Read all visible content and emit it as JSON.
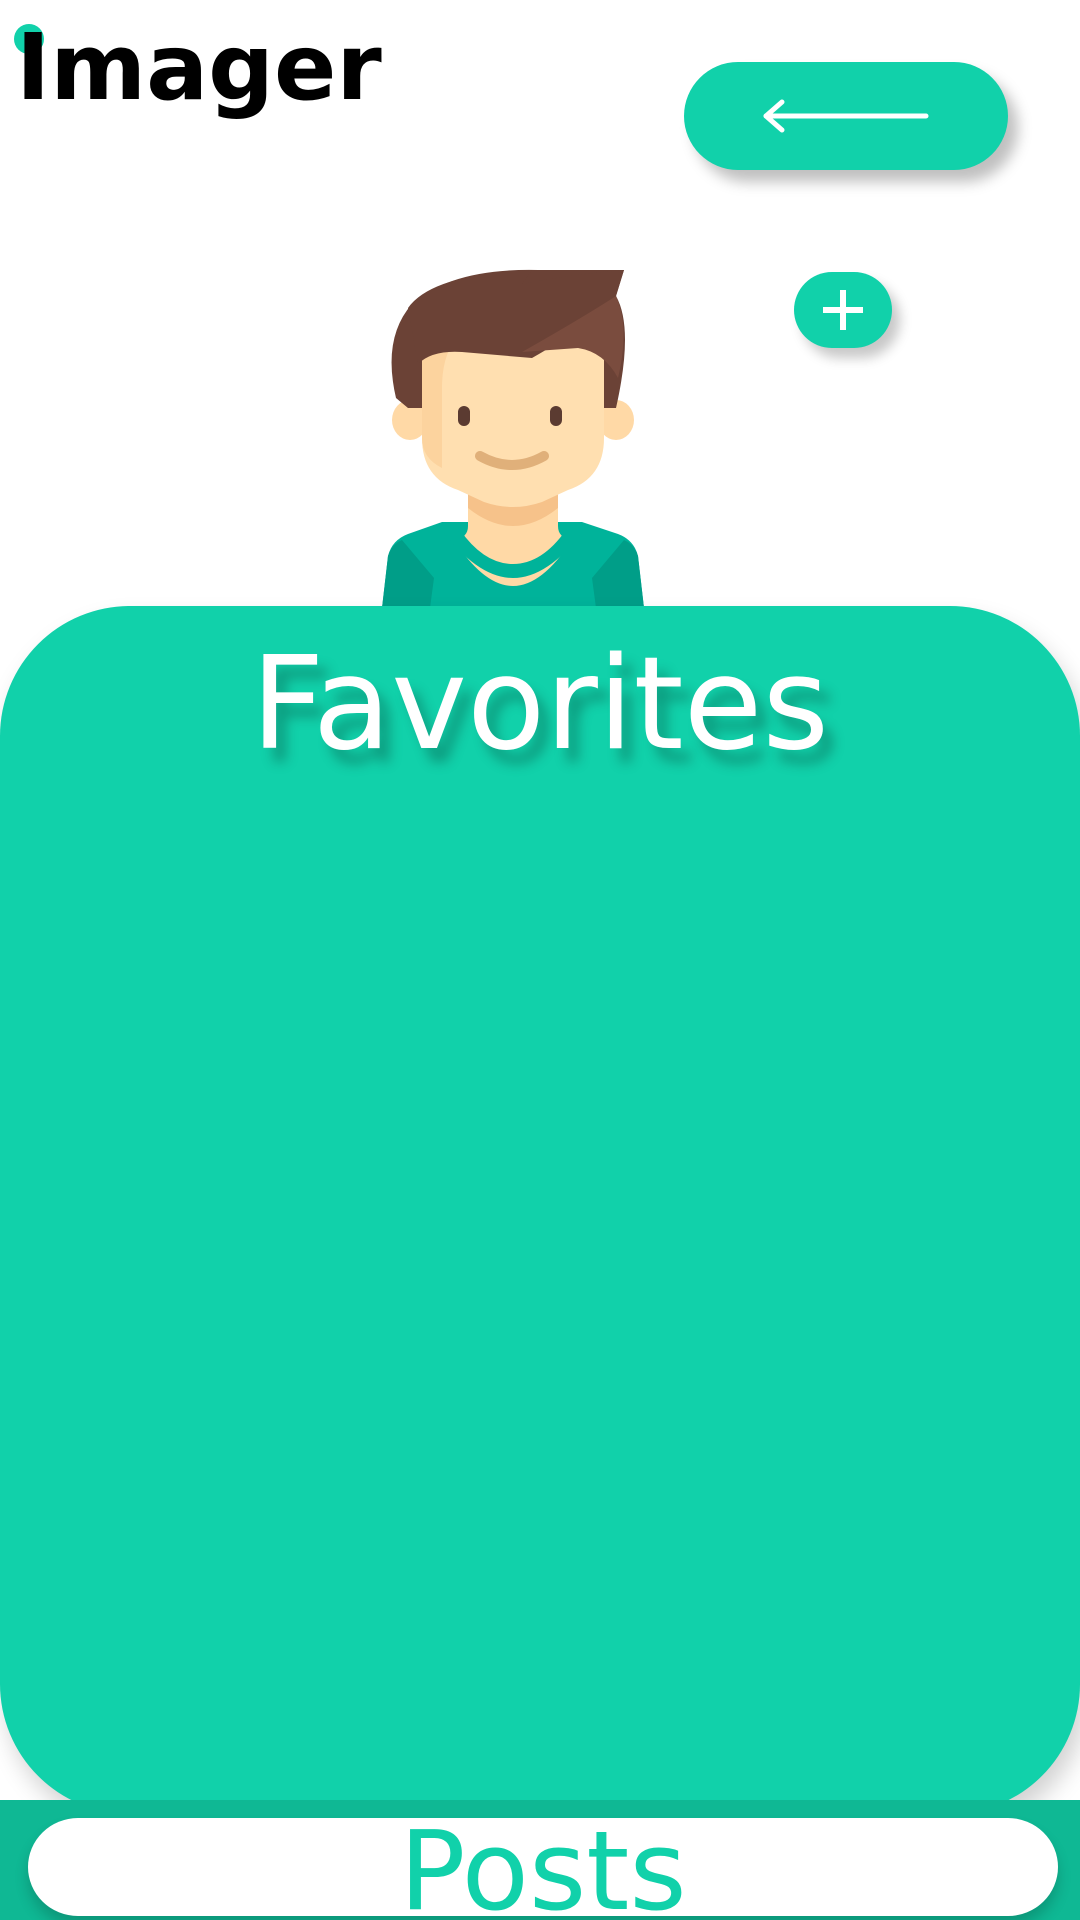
{
  "app": {
    "title": "Imager"
  },
  "colors": {
    "accent": "#11d1aa",
    "band": "#0fb894",
    "text_dark": "#000000",
    "text_light": "#ffffff"
  },
  "header": {
    "back_icon": "arrow-left-icon",
    "add_icon": "plus-icon"
  },
  "profile": {
    "avatar_icon": "user-avatar-icon"
  },
  "favorites": {
    "title": "Favorites"
  },
  "bottom_nav": {
    "posts_label": "Posts"
  }
}
